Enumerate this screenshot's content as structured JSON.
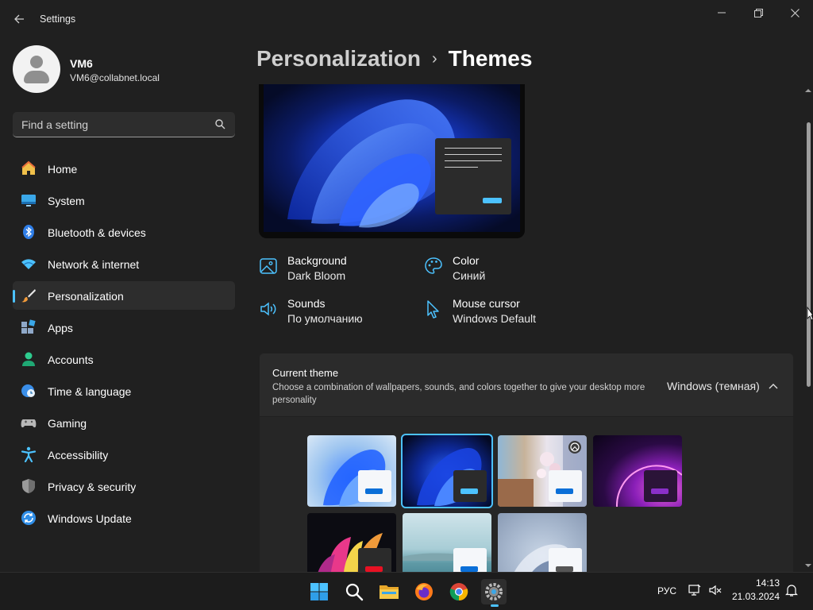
{
  "window": {
    "app_title": "Settings",
    "back_icon": "arrow-left-icon",
    "controls": [
      "minimize-icon",
      "restore-icon",
      "close-icon"
    ]
  },
  "profile": {
    "name": "VM6",
    "email": "VM6@collabnet.local"
  },
  "search": {
    "placeholder": "Find a setting",
    "value": ""
  },
  "sidebar": {
    "items": [
      {
        "label": "Home",
        "icon": "home-icon",
        "active": false
      },
      {
        "label": "System",
        "icon": "monitor-icon",
        "active": false
      },
      {
        "label": "Bluetooth & devices",
        "icon": "bluetooth-icon",
        "active": false
      },
      {
        "label": "Network & internet",
        "icon": "wifi-icon",
        "active": false
      },
      {
        "label": "Personalization",
        "icon": "paintbrush-icon",
        "active": true
      },
      {
        "label": "Apps",
        "icon": "apps-icon",
        "active": false
      },
      {
        "label": "Accounts",
        "icon": "person-icon",
        "active": false
      },
      {
        "label": "Time & language",
        "icon": "globe-clock-icon",
        "active": false
      },
      {
        "label": "Gaming",
        "icon": "gamepad-icon",
        "active": false
      },
      {
        "label": "Accessibility",
        "icon": "accessibility-icon",
        "active": false
      },
      {
        "label": "Privacy & security",
        "icon": "shield-icon",
        "active": false
      },
      {
        "label": "Windows Update",
        "icon": "update-icon",
        "active": false
      }
    ]
  },
  "breadcrumb": {
    "parent": "Personalization",
    "separator": "›",
    "current": "Themes"
  },
  "properties": {
    "background": {
      "title": "Background",
      "value": "Dark Bloom"
    },
    "color": {
      "title": "Color",
      "value": "Синий"
    },
    "sounds": {
      "title": "Sounds",
      "value": "По умолчанию"
    },
    "mouse_cursor": {
      "title": "Mouse cursor",
      "value": "Windows Default"
    }
  },
  "current_theme": {
    "title": "Current theme",
    "description": "Choose a combination of wallpapers, sounds, and colors together to give your desktop more personality",
    "value": "Windows (темная)"
  },
  "themes": [
    {
      "id": "windows-light",
      "selected": false
    },
    {
      "id": "windows-dark",
      "selected": true
    },
    {
      "id": "spotlight",
      "selected": false
    },
    {
      "id": "glow",
      "selected": false
    },
    {
      "id": "captured-motion",
      "selected": false
    },
    {
      "id": "sunrise",
      "selected": false
    },
    {
      "id": "flow",
      "selected": false
    }
  ],
  "taskbar": {
    "apps": [
      "start-icon",
      "search-icon",
      "file-explorer-icon",
      "firefox-icon",
      "chrome-icon",
      "settings-icon"
    ],
    "language": "РУС",
    "time": "14:13",
    "date": "21.03.2024"
  },
  "colors": {
    "accent": "#4cc2ff",
    "background": "#202020",
    "card": "#2b2b2b",
    "sidebar_active": "#2d2d2d"
  }
}
